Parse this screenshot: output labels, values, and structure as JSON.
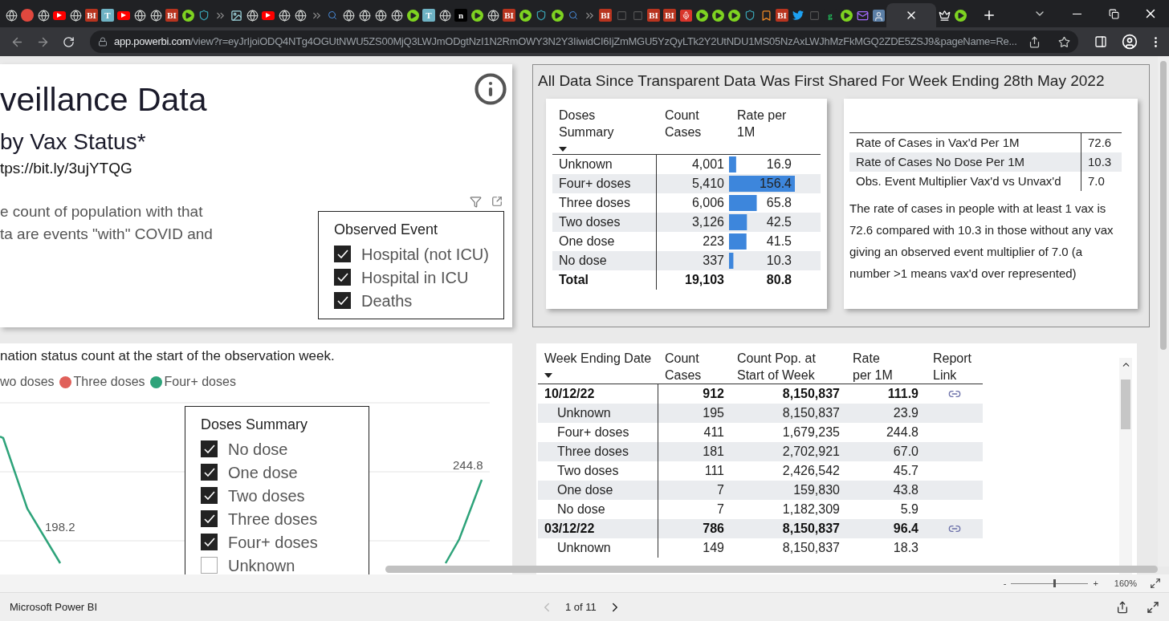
{
  "browser": {
    "tabs": [
      {
        "kind": "globe",
        "selected": false
      },
      {
        "kind": "dot",
        "color": "#e0483e",
        "selected": false
      },
      {
        "kind": "globe",
        "selected": false
      },
      {
        "kind": "youtube",
        "selected": false
      },
      {
        "kind": "globe",
        "selected": false
      },
      {
        "kind": "letters",
        "text": "BI",
        "color": "#b8341f",
        "selected": false
      },
      {
        "kind": "letters",
        "text": "T",
        "color": "#6fb3c4",
        "selected": false
      },
      {
        "kind": "youtube",
        "selected": false
      },
      {
        "kind": "globe",
        "selected": false
      },
      {
        "kind": "globe",
        "selected": false
      },
      {
        "kind": "letters",
        "text": "BI",
        "color": "#b8341f",
        "selected": false
      },
      {
        "kind": "play",
        "selected": false
      },
      {
        "kind": "shield",
        "selected": false
      },
      {
        "kind": "arrow",
        "selected": false
      },
      {
        "kind": "image",
        "selected": false
      },
      {
        "kind": "globe",
        "selected": false
      },
      {
        "kind": "youtube",
        "selected": false
      },
      {
        "kind": "globe",
        "selected": false
      },
      {
        "kind": "globe",
        "selected": false
      },
      {
        "kind": "arrow",
        "selected": false
      },
      {
        "kind": "search",
        "selected": false
      },
      {
        "kind": "globe",
        "selected": false
      },
      {
        "kind": "globe",
        "selected": false
      },
      {
        "kind": "globe",
        "selected": false
      },
      {
        "kind": "globe",
        "selected": false
      },
      {
        "kind": "play",
        "selected": false
      },
      {
        "kind": "letters",
        "text": "T",
        "color": "#6fb3c4",
        "selected": false
      },
      {
        "kind": "globe",
        "selected": false
      },
      {
        "kind": "letters",
        "text": "n",
        "color": "#000000",
        "selected": false
      },
      {
        "kind": "play",
        "selected": false
      },
      {
        "kind": "globe",
        "selected": false
      },
      {
        "kind": "letters",
        "text": "BI",
        "color": "#b8341f",
        "selected": false
      },
      {
        "kind": "play",
        "selected": false
      },
      {
        "kind": "shield",
        "selected": false
      },
      {
        "kind": "play",
        "selected": false
      },
      {
        "kind": "search",
        "selected": false
      },
      {
        "kind": "arrow",
        "selected": false
      },
      {
        "kind": "letters",
        "text": "BI",
        "color": "#b8341f",
        "selected": false
      },
      {
        "kind": "dark",
        "selected": false
      },
      {
        "kind": "dark",
        "selected": false
      },
      {
        "kind": "letters",
        "text": "BI",
        "color": "#b8341f",
        "selected": false
      },
      {
        "kind": "letters",
        "text": "BI",
        "color": "#b8341f",
        "selected": false
      },
      {
        "kind": "mic",
        "selected": false
      },
      {
        "kind": "play",
        "selected": false
      },
      {
        "kind": "play",
        "selected": false
      },
      {
        "kind": "play",
        "selected": false
      },
      {
        "kind": "shield",
        "selected": false
      },
      {
        "kind": "bookmark",
        "selected": false
      },
      {
        "kind": "letters",
        "text": "BI",
        "color": "#b8341f",
        "selected": false
      },
      {
        "kind": "twitter",
        "selected": false
      },
      {
        "kind": "dark",
        "selected": false
      },
      {
        "kind": "glyph",
        "text": "g",
        "color": "#22c55e",
        "selected": false
      },
      {
        "kind": "play",
        "selected": false
      },
      {
        "kind": "mail",
        "selected": false
      },
      {
        "kind": "avatar",
        "selected": false
      },
      {
        "kind": "close",
        "selected": true
      },
      {
        "kind": "crown",
        "selected": false
      },
      {
        "kind": "play",
        "selected": false
      }
    ],
    "address": {
      "host": "app.powerbi.com",
      "path": "/view?r=eyJrIjoiODQ4NTg4OGUtNWU5ZS00MjQ3LWJmODgtNzI1N2RmOWY3N2Y3IiwidCI6IjZmMGU5YzQyLTk2Y2UtNDU1MS05NzAxLWJhMzFkMGQ2ZDE5ZSJ9&pageName=Re..."
    }
  },
  "header_panel": {
    "title": "veillance Data",
    "subtitle": "by Vax Status*",
    "link": "tps://bit.ly/3ujYTQG",
    "description": [
      "e count of population with that",
      "ta are events \"with\" COVID and"
    ]
  },
  "observed_event_slicer": {
    "title": "Observed Event",
    "items": [
      {
        "label": "Hospital (not ICU)",
        "checked": true
      },
      {
        "label": "Hospital in ICU",
        "checked": true
      },
      {
        "label": "Deaths",
        "checked": true
      }
    ]
  },
  "chart_panel": {
    "caption": "nation status count at the start of the observation week.",
    "legend": [
      {
        "label": "wo doses"
      },
      {
        "label": "Three doses",
        "color": "#e0605a"
      },
      {
        "label": "Four+ doses",
        "color": "#2ea37a"
      }
    ],
    "data_labels": [
      "198.2",
      "244.8"
    ]
  },
  "doses_slicer": {
    "title": "Doses Summary",
    "items": [
      {
        "label": "No dose",
        "checked": true
      },
      {
        "label": "One dose",
        "checked": true
      },
      {
        "label": "Two doses",
        "checked": true
      },
      {
        "label": "Three doses",
        "checked": true
      },
      {
        "label": "Four+ doses",
        "checked": true
      },
      {
        "label": "Unknown",
        "checked": false
      }
    ]
  },
  "summary_panel": {
    "title": "All Data Since Transparent Data Was First Shared For Week Ending 28th May 2022",
    "doses_table": {
      "columns": [
        "Doses Summary",
        "Count Cases",
        "Rate per 1M"
      ],
      "rows": [
        {
          "label": "Unknown",
          "count": "4,001",
          "rate": "16.9",
          "level": 0.108
        },
        {
          "label": "Four+ doses",
          "count": "5,410",
          "rate": "156.4",
          "level": 1
        },
        {
          "label": "Three doses",
          "count": "6,006",
          "rate": "65.8",
          "level": 0.421
        },
        {
          "label": "Two doses",
          "count": "3,126",
          "rate": "42.5",
          "level": 0.272
        },
        {
          "label": "One dose",
          "count": "223",
          "rate": "41.5",
          "level": 0.265
        },
        {
          "label": "No dose",
          "count": "337",
          "rate": "10.3",
          "level": 0.066
        }
      ],
      "total": {
        "label": "Total",
        "count": "19,103",
        "rate": "80.8"
      }
    },
    "multiplier_table": {
      "rows": [
        {
          "label": "Rate of Cases in Vax'd Per 1M",
          "value": "72.6"
        },
        {
          "label": "Rate of Cases No Dose Per 1M",
          "value": "10.3"
        },
        {
          "label": "Obs. Event Multiplier Vax'd vs Unvax'd",
          "value": "7.0"
        }
      ]
    },
    "note": "The rate of cases in people with at least 1 vax is 72.6 compared with 10.3 in those without any vax giving an observed event multiplier of 7.0 (a number >1 means vax'd over represented)"
  },
  "weekly_table": {
    "columns": [
      "Week Ending Date",
      "Count Cases",
      "Count Pop. at Start of Week",
      "Rate per 1M",
      "Report Link"
    ],
    "rows": [
      {
        "kind": "group",
        "label": "10/12/22",
        "count": "912",
        "population": "8,150,837",
        "rate": "111.9",
        "link": true
      },
      {
        "kind": "item",
        "label": "Unknown",
        "count": "195",
        "population": "8,150,837",
        "rate": "23.9",
        "link": false
      },
      {
        "kind": "item",
        "label": "Four+ doses",
        "count": "411",
        "population": "1,679,235",
        "rate": "244.8",
        "link": false
      },
      {
        "kind": "item",
        "label": "Three doses",
        "count": "181",
        "population": "2,702,921",
        "rate": "67.0",
        "link": false
      },
      {
        "kind": "item",
        "label": "Two doses",
        "count": "111",
        "population": "2,426,542",
        "rate": "45.7",
        "link": false
      },
      {
        "kind": "item",
        "label": "One dose",
        "count": "7",
        "population": "159,830",
        "rate": "43.8",
        "link": false
      },
      {
        "kind": "item",
        "label": "No dose",
        "count": "7",
        "population": "1,182,309",
        "rate": "5.9",
        "link": false
      },
      {
        "kind": "group",
        "label": "03/12/22",
        "count": "786",
        "population": "8,150,837",
        "rate": "96.4",
        "link": true
      },
      {
        "kind": "item",
        "label": "Unknown",
        "count": "149",
        "population": "8,150,837",
        "rate": "18.3",
        "link": false
      }
    ]
  },
  "zoom": {
    "minus": "-",
    "plus": "+",
    "level": 0.55,
    "percent": "160%"
  },
  "status_bar": {
    "app": "Microsoft Power BI",
    "page": "1 of 11",
    "prev_disabled": true
  }
}
